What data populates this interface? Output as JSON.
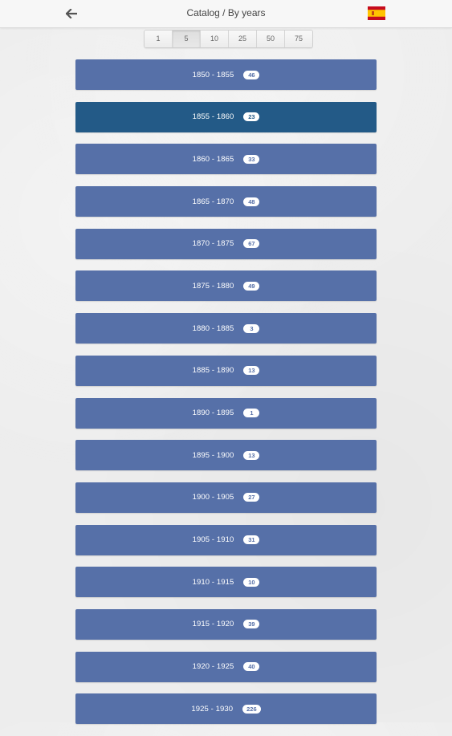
{
  "header": {
    "title": "Catalog / By years",
    "back_icon": "arrow-left-icon",
    "flag_icon": "spain-flag-icon"
  },
  "pager": {
    "options": [
      "1",
      "5",
      "10",
      "25",
      "50",
      "75"
    ],
    "selected": "5"
  },
  "colors": {
    "row": "#5670a8",
    "row_selected": "#235a87",
    "background": "#ededed"
  },
  "periods": [
    {
      "range": "1850 - 1855",
      "count": "46"
    },
    {
      "range": "1855 - 1860",
      "count": "23"
    },
    {
      "range": "1860 - 1865",
      "count": "33"
    },
    {
      "range": "1865 - 1870",
      "count": "48"
    },
    {
      "range": "1870 - 1875",
      "count": "67"
    },
    {
      "range": "1875 - 1880",
      "count": "49"
    },
    {
      "range": "1880 - 1885",
      "count": "3"
    },
    {
      "range": "1885 - 1890",
      "count": "13"
    },
    {
      "range": "1890 - 1895",
      "count": "1"
    },
    {
      "range": "1895 - 1900",
      "count": "13"
    },
    {
      "range": "1900 - 1905",
      "count": "27"
    },
    {
      "range": "1905 - 1910",
      "count": "31"
    },
    {
      "range": "1910 - 1915",
      "count": "10"
    },
    {
      "range": "1915 - 1920",
      "count": "39"
    },
    {
      "range": "1920 - 1925",
      "count": "40"
    },
    {
      "range": "1925 - 1930",
      "count": "226"
    }
  ],
  "selected_period": "1855 - 1860"
}
